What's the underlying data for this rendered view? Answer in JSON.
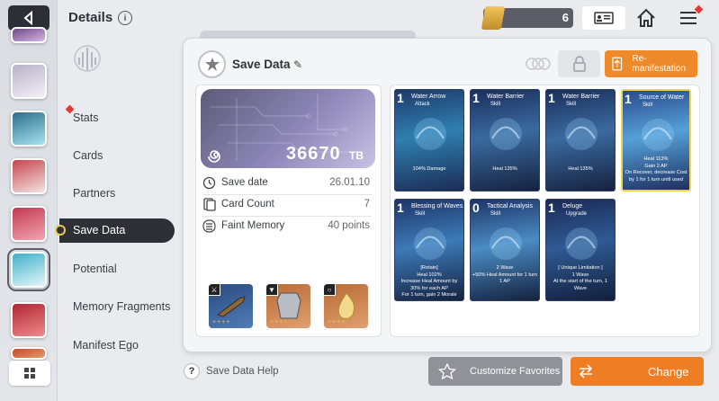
{
  "header": {
    "title": "Details",
    "resource_count": "6"
  },
  "nav": {
    "items": [
      {
        "label": "Stats"
      },
      {
        "label": "Cards"
      },
      {
        "label": "Partners"
      },
      {
        "label": "Save Data"
      },
      {
        "label": "Potential"
      },
      {
        "label": "Memory Fragments"
      },
      {
        "label": "Manifest Ego"
      }
    ],
    "selected": "Save Data"
  },
  "save": {
    "title": "Save Data",
    "remanifest_label": "Re-manifestation",
    "tb_value": "36670",
    "tb_unit": "TB",
    "stats": [
      {
        "label": "Save date",
        "value": "26.01.10",
        "icon": "clock-icon"
      },
      {
        "label": "Card Count",
        "value": "7",
        "icon": "card-icon"
      },
      {
        "label": "Faint Memory",
        "value": "40 points",
        "icon": "memory-icon"
      }
    ],
    "equipment": [
      {
        "type": "weapon",
        "icon": "sword-icon",
        "stars": "++++",
        "color": "#3d5f94"
      },
      {
        "type": "armor",
        "icon": "armor-icon",
        "stars": "++++",
        "color": "#c8783f"
      },
      {
        "type": "accessory",
        "icon": "ring-icon",
        "stars": "++++",
        "color": "#c8783f"
      }
    ]
  },
  "cards": [
    {
      "cost": "1",
      "name": "Water Arrow",
      "type": "Attack",
      "desc": "104% Damage"
    },
    {
      "cost": "1",
      "name": "Water Barrier",
      "type": "Skill",
      "desc": "Heal 135%"
    },
    {
      "cost": "1",
      "name": "Water Barrier",
      "type": "Skill",
      "desc": "Heal 135%"
    },
    {
      "cost": "1",
      "name": "Source of Water",
      "type": "Skill",
      "desc": "Heal 113%\nGain 2 AP\nOn Recover, decrease Cost by 1 for 1 turn until used"
    },
    {
      "cost": "1",
      "name": "Blessing of Waves",
      "type": "Skill",
      "desc": "[Retain]\nHeal 102%\nIncrease Heal Amount by 30% for each AP\nFor 1 turn, gain 2 Morale"
    },
    {
      "cost": "0",
      "name": "Tactical Analysis",
      "type": "Skill",
      "desc": "2 Wave\n+50% Heal Amount for 1 turn\n1 AP"
    },
    {
      "cost": "1",
      "name": "Deluge",
      "type": "Upgrade",
      "desc": "[ Unique Limitation ]\n1 Wave\nAt the start of the turn, 1 Wave"
    }
  ],
  "footer": {
    "help_label": "Save Data Help",
    "customize_label": "Customize Favorites",
    "change_label": "Change"
  },
  "colors": {
    "accent_orange": "#ef7d24",
    "dark": "#2e3037",
    "card_blue": "#1d3466"
  }
}
